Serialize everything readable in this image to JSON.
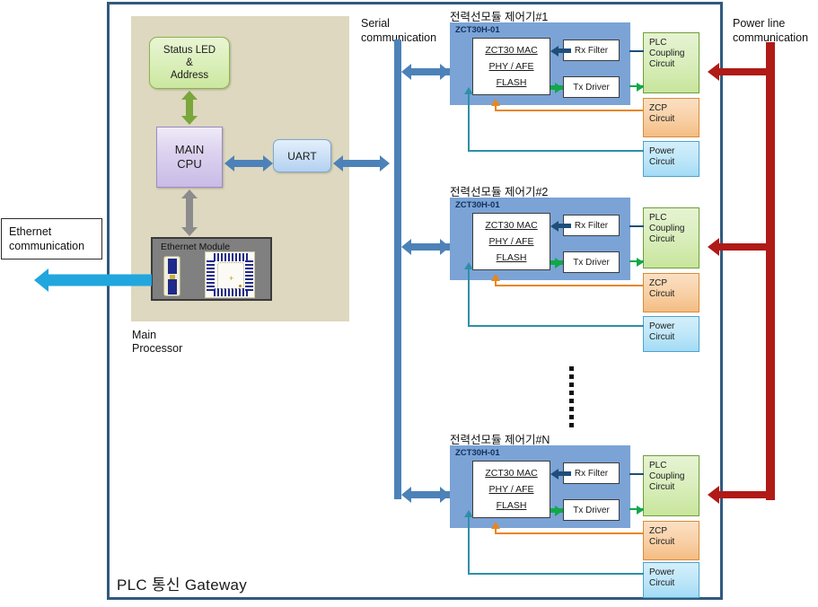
{
  "diagram": {
    "frame_title": "PLC 통신 Gateway",
    "border_color": "#31597d"
  },
  "processor": {
    "panel_color": "#ddd8bf",
    "caption": "Main\nProcessor",
    "status_led": {
      "label": "Status LED\n&\nAddress",
      "color": "#cbe79f"
    },
    "main_cpu": {
      "label": "MAIN\nCPU",
      "color": "#c9bbe6"
    },
    "uart": {
      "label": "UART",
      "color": "#b3d1f0"
    },
    "ethernet_module": {
      "label": "Ethernet Module",
      "color": "#808080"
    }
  },
  "labels": {
    "ethernet": "Ethernet\ncommunication",
    "serial": "Serial\ncommunication",
    "powerline": "Power line\ncommunication"
  },
  "buses": {
    "serial_color": "#4d82b8",
    "powerline_color": "#b01a17",
    "ethernet_arrow_color": "#21a6dd"
  },
  "module_template": {
    "board_label": "ZCT30H-01",
    "board_color": "#7ba3d6",
    "chip_lines": [
      "ZCT30 MAC",
      "PHY / AFE",
      "FLASH"
    ],
    "rx_filter": "Rx Filter",
    "tx_driver": "Tx Driver",
    "plc_coupling": "PLC\nCoupling\nCircuit",
    "zcp_circuit": "ZCP\nCircuit",
    "power_circuit": "Power\nCircuit",
    "rx_line_color": "#1f4e79",
    "tx_line_color": "#11a84a",
    "zcp_line_color": "#e8861f",
    "power_line_color": "#2f8fa8"
  },
  "modules": [
    {
      "title": "전력선모듈 제어기#1"
    },
    {
      "title": "전력선모듈 제어기#2"
    },
    {
      "title": "전력선모듈 제어기#N"
    }
  ],
  "continuation": {
    "symbol": "vertical-ellipsis",
    "dots": 8
  }
}
